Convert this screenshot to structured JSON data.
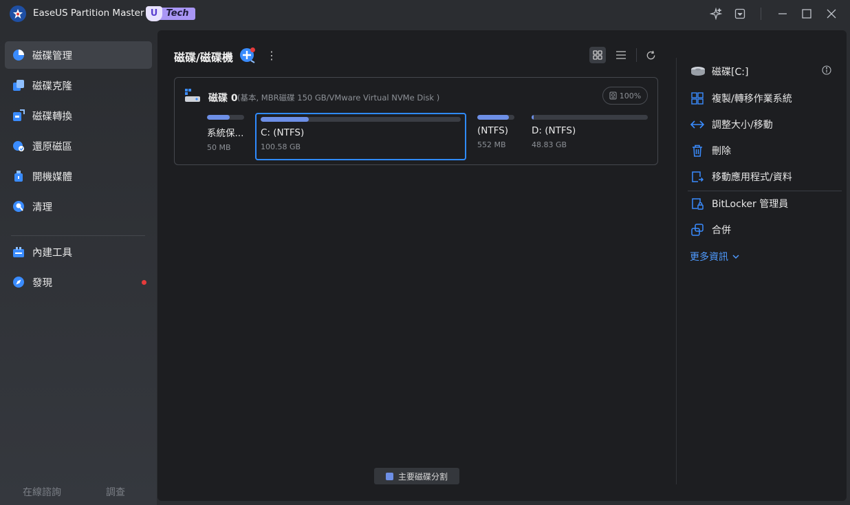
{
  "app": {
    "title": "EaseUS Partition Master",
    "badge_u": "U",
    "badge_text": "Tech"
  },
  "window_controls": [
    "sparkle-icon",
    "dropdown-icon",
    "minimize-icon",
    "maximize-icon",
    "close-icon"
  ],
  "sidebar": {
    "items": [
      {
        "label": "磁碟管理",
        "icon": "disk-management-icon",
        "active": true
      },
      {
        "label": "磁碟克隆",
        "icon": "disk-clone-icon"
      },
      {
        "label": "磁碟轉換",
        "icon": "disk-convert-icon"
      },
      {
        "label": "還原磁區",
        "icon": "recover-partition-icon"
      },
      {
        "label": "開機媒體",
        "icon": "bootable-media-icon"
      },
      {
        "label": "清理",
        "icon": "cleanup-icon"
      },
      {
        "label": "內建工具",
        "icon": "toolkit-icon"
      },
      {
        "label": "發現",
        "icon": "discover-icon",
        "notification": true
      }
    ],
    "footer": {
      "consult": "在線諮詢",
      "survey": "調查"
    }
  },
  "main": {
    "title": "磁碟/磁碟機",
    "disk": {
      "name": "磁碟 0",
      "description": "(基本, MBR磁碟 150 GB/VMware Virtual NVMe Disk )",
      "health": "100%",
      "partitions": [
        {
          "name": "系統保...",
          "size": "50 MB",
          "used": 0.62
        },
        {
          "name": "C: (NTFS)",
          "size": "100.58 GB",
          "used": 0.24,
          "selected": true
        },
        {
          "name": "(NTFS)",
          "size": "552 MB",
          "used": 0.85
        },
        {
          "name": "D: (NTFS)",
          "size": "48.83 GB",
          "used": 0.02
        }
      ]
    },
    "legend": "主要磁碟分割"
  },
  "right_panel": {
    "title": "磁碟[C:]",
    "actions": [
      {
        "label": "複製/轉移作業系統",
        "icon": "migrate-os-icon"
      },
      {
        "label": "調整大小/移動",
        "icon": "resize-move-icon"
      },
      {
        "label": "刪除",
        "icon": "delete-icon"
      },
      {
        "label": "移動應用程式/資料",
        "icon": "app-migration-icon"
      },
      {
        "label": "BitLocker 管理員",
        "icon": "bitlocker-icon"
      },
      {
        "label": "合併",
        "icon": "merge-icon"
      }
    ],
    "more": "更多資訊"
  },
  "colors": {
    "accent": "#2f8bff",
    "partition_fill": "#6d8fe6",
    "link": "#4f9bff",
    "notification": "#e53b3b"
  }
}
